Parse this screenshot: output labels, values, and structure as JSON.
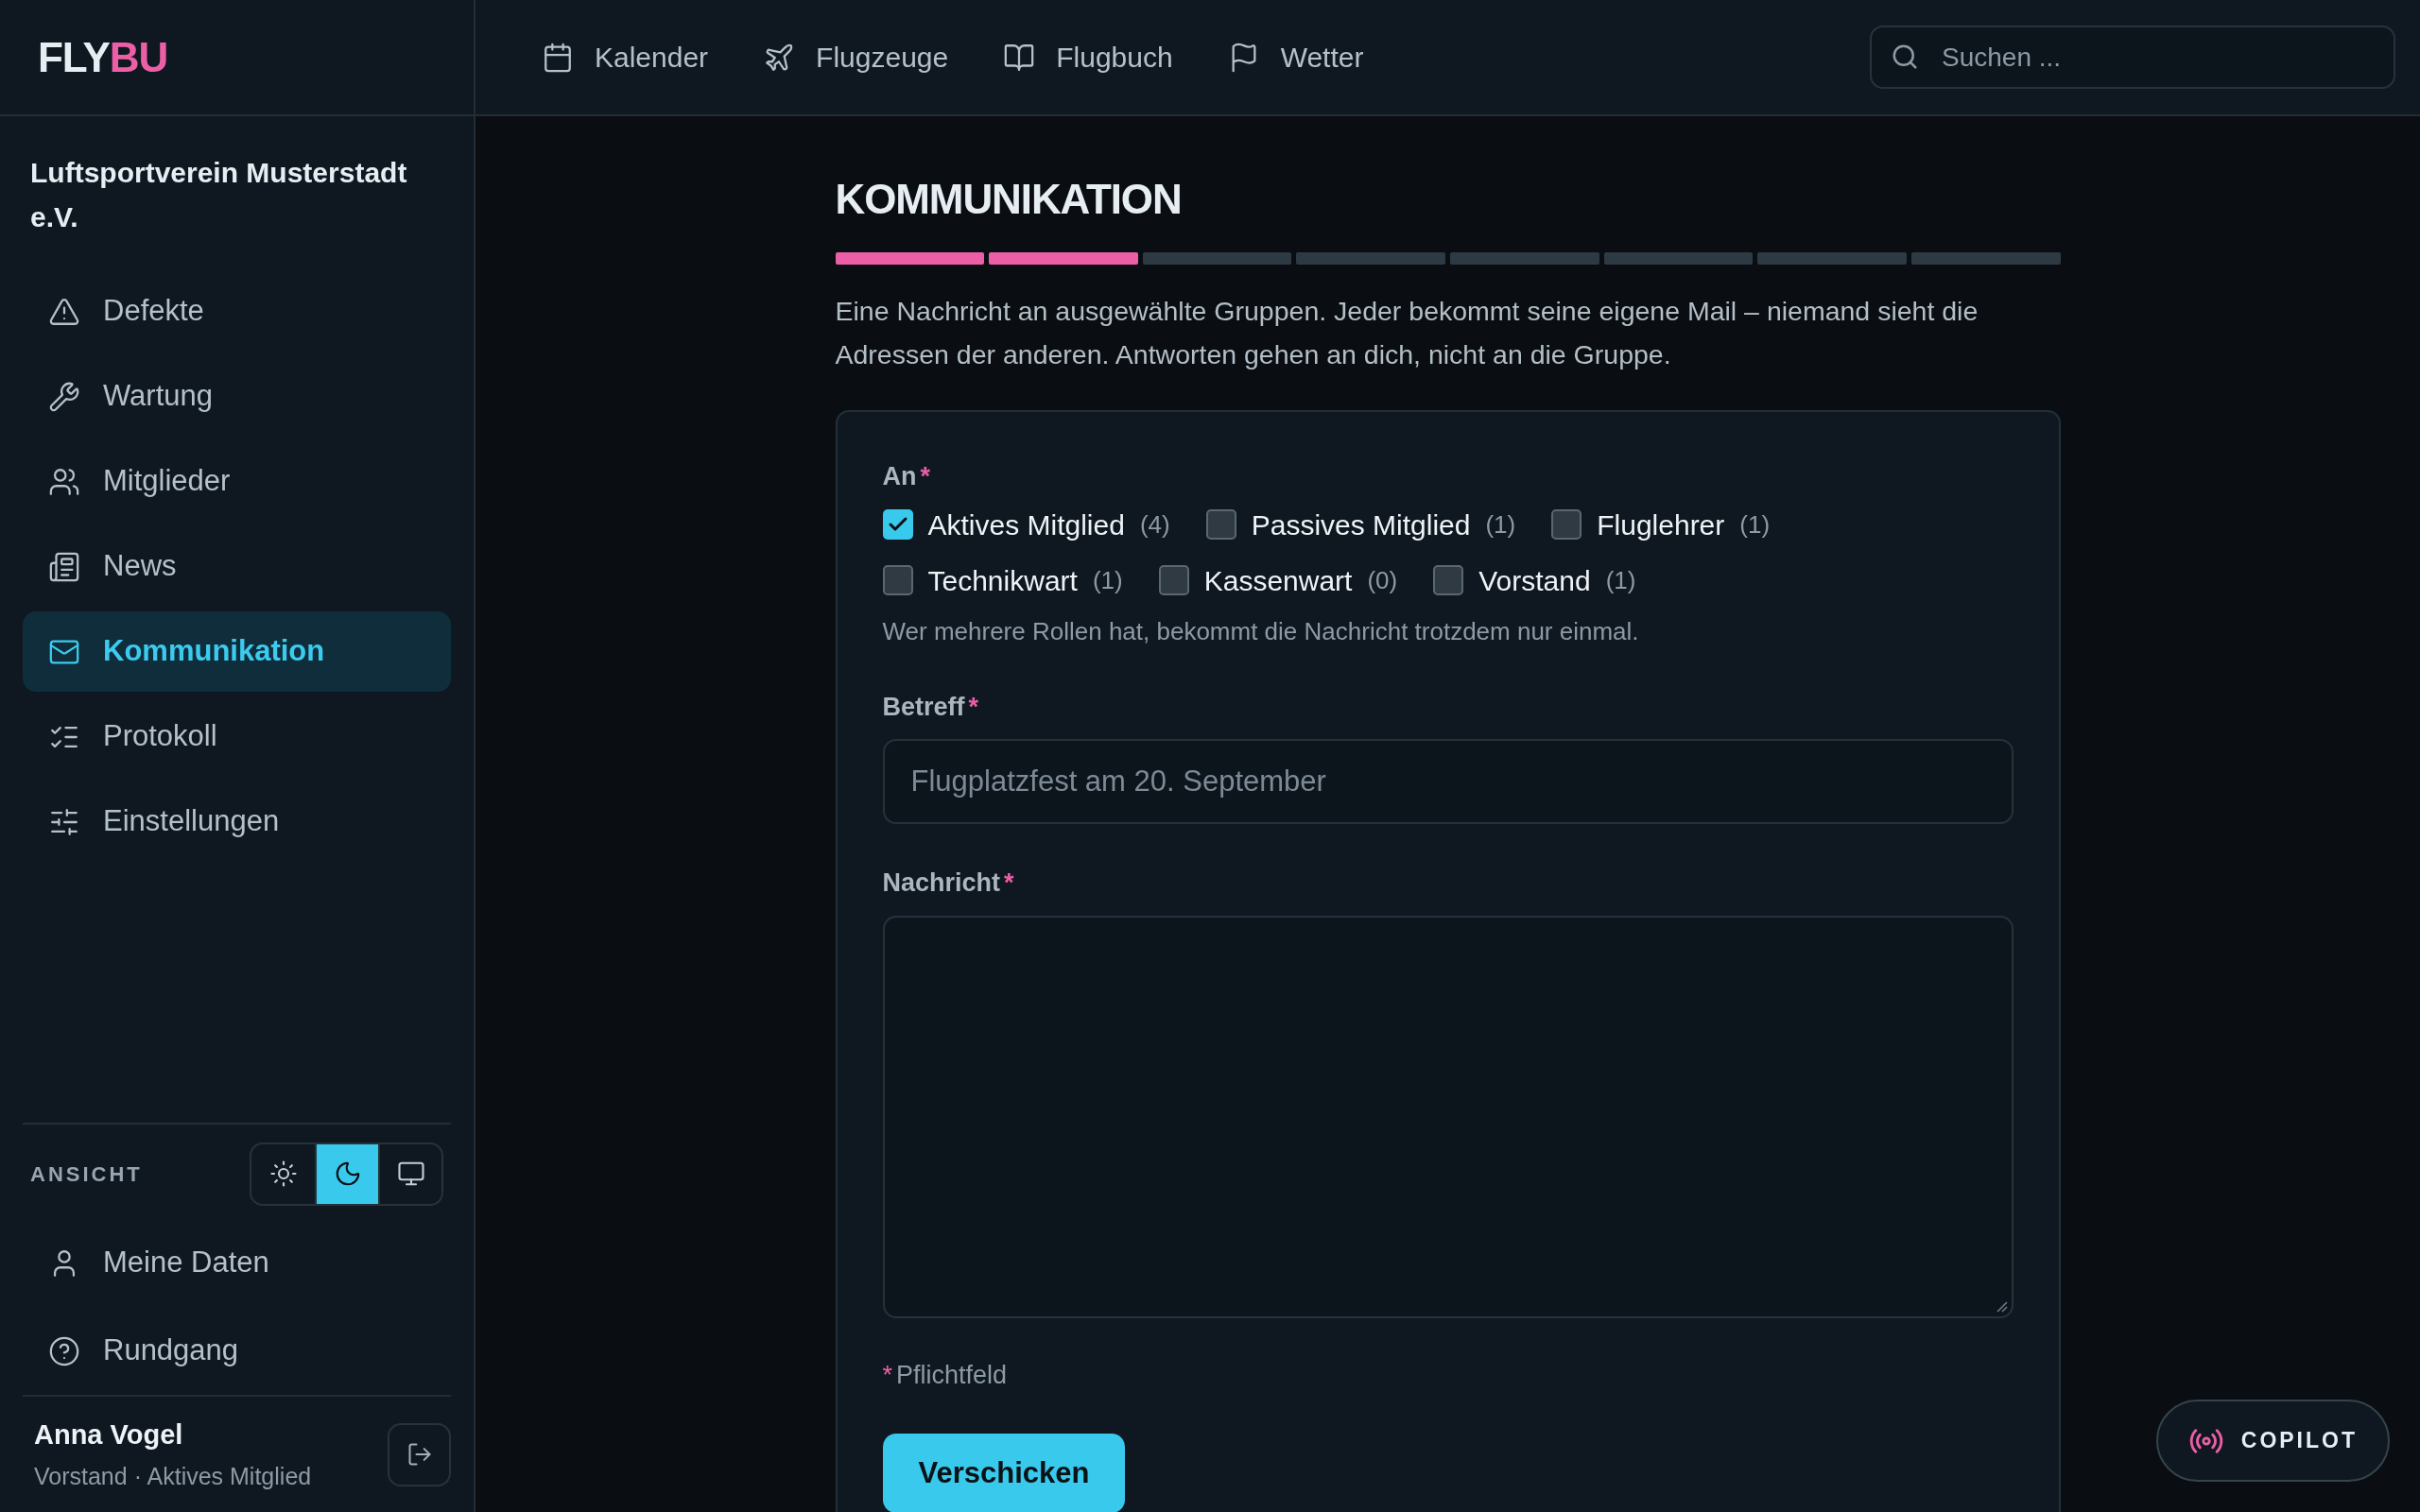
{
  "logo": {
    "primary": "FLY",
    "accent": "BU"
  },
  "top_nav": [
    {
      "label": "Kalender"
    },
    {
      "label": "Flugzeuge"
    },
    {
      "label": "Flugbuch"
    },
    {
      "label": "Wetter"
    }
  ],
  "search": {
    "placeholder": "Suchen ..."
  },
  "sidebar": {
    "org": "Luftsportverein Musterstadt e.V.",
    "items": [
      {
        "label": "Defekte",
        "selected": false
      },
      {
        "label": "Wartung",
        "selected": false
      },
      {
        "label": "Mitglieder",
        "selected": false
      },
      {
        "label": "News",
        "selected": false
      },
      {
        "label": "Kommunikation",
        "selected": true
      },
      {
        "label": "Protokoll",
        "selected": false
      },
      {
        "label": "Einstellungen",
        "selected": false
      }
    ],
    "view": {
      "label": "ANSICHT",
      "modes": [
        {
          "selected": false
        },
        {
          "selected": true
        },
        {
          "selected": false
        }
      ]
    },
    "footer_items": [
      {
        "label": "Meine Daten"
      },
      {
        "label": "Rundgang"
      }
    ],
    "user": {
      "name": "Anna Vogel",
      "roles": "Vorstand · Aktives Mitglied"
    }
  },
  "page": {
    "title": "KOMMUNIKATION",
    "steps": [
      {
        "complete": true
      },
      {
        "complete": true
      },
      {
        "complete": false
      },
      {
        "complete": false
      },
      {
        "complete": false
      },
      {
        "complete": false
      },
      {
        "complete": false
      },
      {
        "complete": false
      }
    ],
    "description": "Eine Nachricht an ausgewählte Gruppen. Jeder bekommt seine eigene Mail – niemand sieht die Adressen der anderen. Antworten gehen an dich, nicht an die Gruppe.",
    "form": {
      "recipients": {
        "label": "An",
        "mark": "*",
        "options": [
          {
            "label": "Aktives Mitglied",
            "count": "(4)",
            "checked": true
          },
          {
            "label": "Passives Mitglied",
            "count": "(1)",
            "checked": false
          },
          {
            "label": "Fluglehrer",
            "count": "(1)",
            "checked": false
          },
          {
            "label": "Technikwart",
            "count": "(1)",
            "checked": false
          },
          {
            "label": "Kassenwart",
            "count": "(0)",
            "checked": false
          },
          {
            "label": "Vorstand",
            "count": "(1)",
            "checked": false
          }
        ],
        "hint": "Wer mehrere Rollen hat, bekommt die Nachricht trotzdem nur einmal."
      },
      "subject": {
        "label": "Betreff",
        "mark": "*",
        "placeholder": "Flugplatzfest am 20. September"
      },
      "message": {
        "label": "Nachricht",
        "mark": "*"
      },
      "required_note": {
        "mark": "*",
        "text": "Pflichtfeld"
      },
      "submit": "Verschicken"
    }
  },
  "copilot": {
    "label": "COPILOT"
  }
}
